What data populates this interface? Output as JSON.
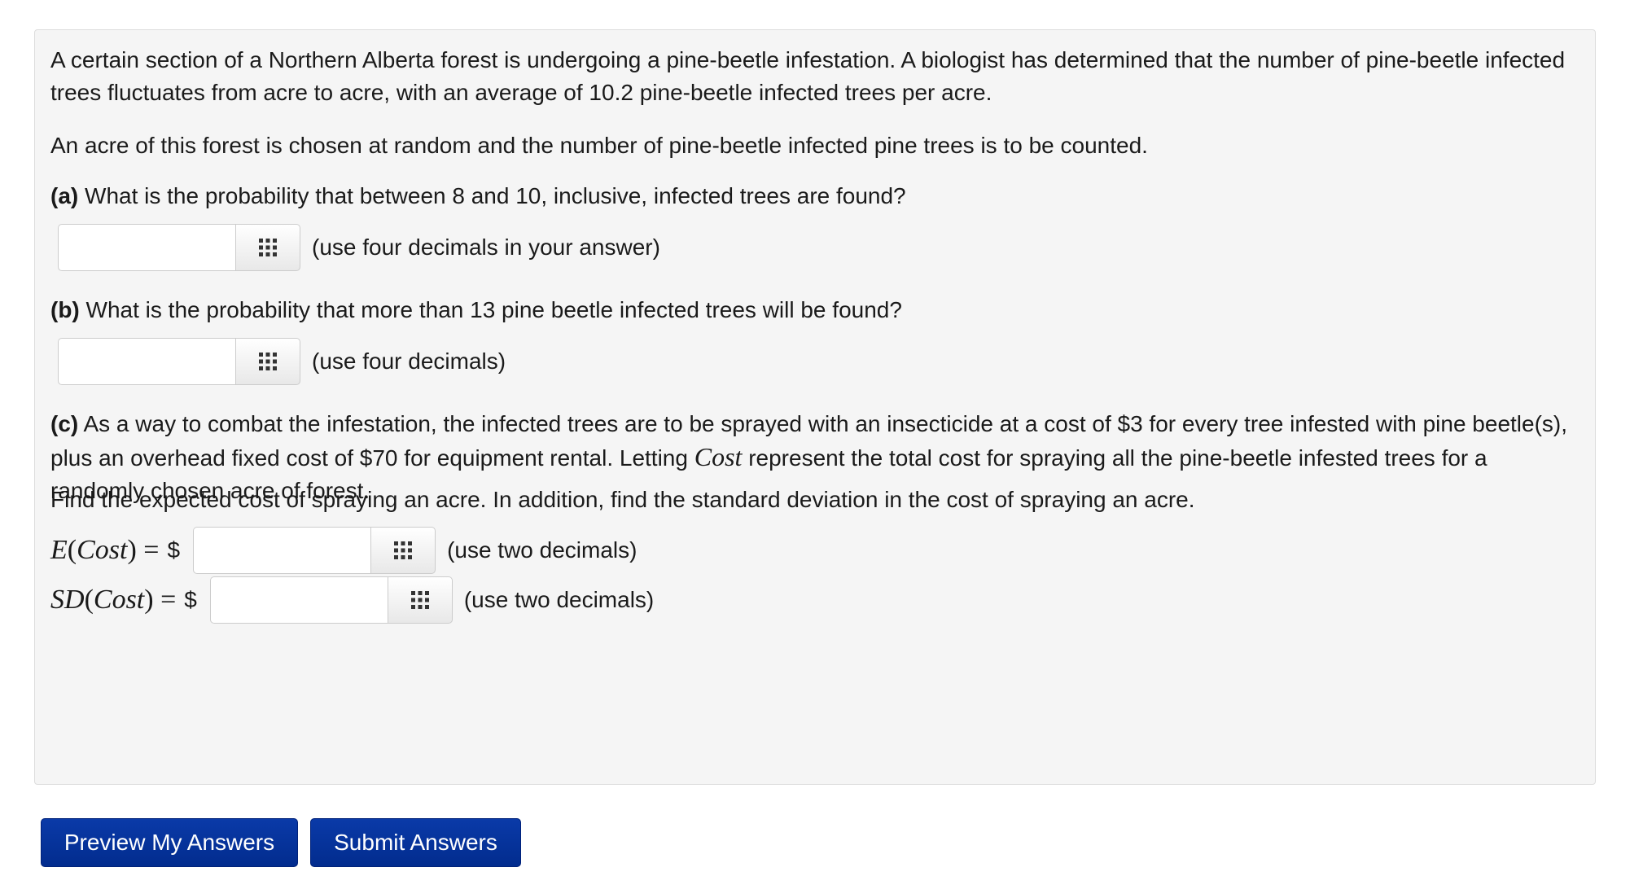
{
  "problem": {
    "intro": "A certain section of a Northern Alberta forest is undergoing a pine-beetle infestation. A biologist has determined that the number of pine-beetle infected trees fluctuates from acre to acre, with an average of 10.2 pine-beetle infected trees per acre.",
    "setup": "An acre of this forest is chosen at random and the number of pine-beetle infected pine trees is to be counted.",
    "part_a": {
      "label": "(a)",
      "question": "What is the probability that between 8 and 10, inclusive, infected trees are found?",
      "answer_value": "",
      "hint": "(use four decimals in your answer)",
      "palette_icon": "grid-icon"
    },
    "part_b": {
      "label": "(b)",
      "question": "What is the probability that more than 13 pine beetle infected trees will be found?",
      "answer_value": "",
      "hint": "(use four decimals)",
      "palette_icon": "grid-icon"
    },
    "part_c": {
      "label": "(c)",
      "text_1": "As a way to combat the infestation, the infected trees are to be sprayed with an insecticide at a cost of $3 for every tree infested with pine beetle(s), plus an overhead fixed cost of $70 for equipment rental. Letting",
      "cost_var": "Cost",
      "text_2": "represent the total cost for spraying all the pine-beetle infested trees for a randomly chosen acre of forest.",
      "text_3": "Find the expected cost of spraying an acre. In addition, find the standard deviation in the cost of spraying an acre.",
      "expected": {
        "func": "E",
        "arg": "Cost",
        "equals": "=",
        "currency": "$",
        "answer_value": "",
        "hint": "(use two decimals)"
      },
      "sd": {
        "func": "SD",
        "arg": "Cost",
        "equals": "=",
        "currency": "$",
        "answer_value": "",
        "hint": "(use two decimals)"
      }
    }
  },
  "buttons": {
    "preview": "Preview My Answers",
    "submit": "Submit Answers"
  },
  "colors": {
    "panel_bg": "#f5f5f5",
    "button_bg": "#022c8e",
    "button_text": "#ffffff"
  }
}
